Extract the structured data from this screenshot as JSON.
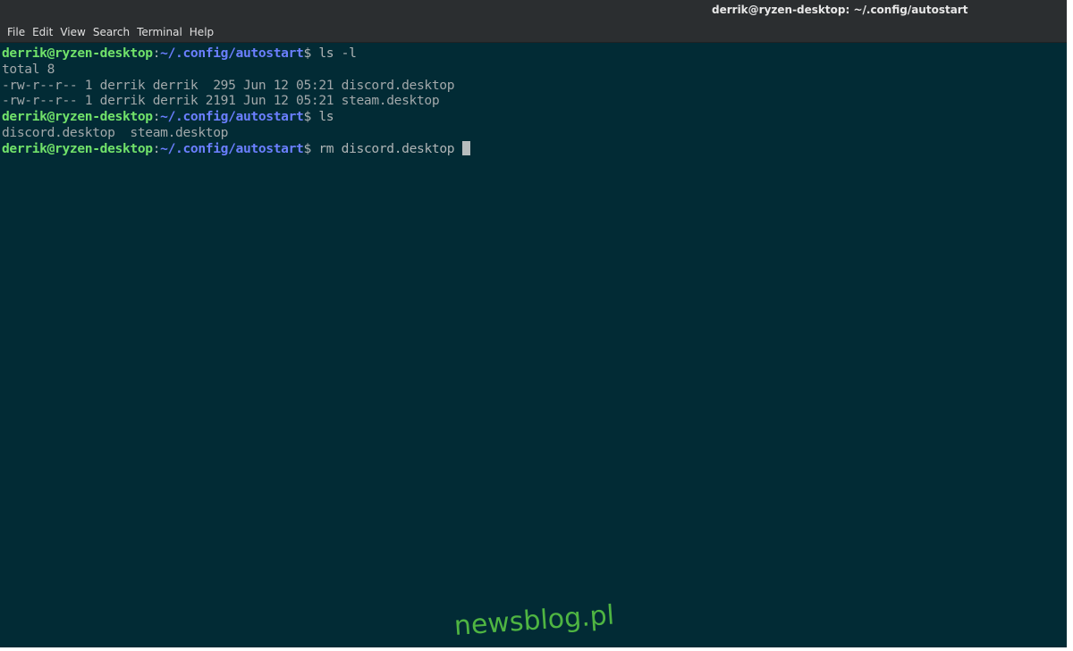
{
  "window": {
    "title": "derrik@ryzen-desktop: ~/.config/autostart"
  },
  "menu": {
    "items": [
      "File",
      "Edit",
      "View",
      "Search",
      "Terminal",
      "Help"
    ]
  },
  "prompt": {
    "user_host": "derrik@ryzen-desktop",
    "colon": ":",
    "path": "~/.config/autostart",
    "dollar": "$"
  },
  "terminal": {
    "cmd1": " ls -l",
    "out_total": "total 8",
    "out_file1": "-rw-r--r-- 1 derrik derrik  295 Jun 12 05:21 discord.desktop",
    "out_file2": "-rw-r--r-- 1 derrik derrik 2191 Jun 12 05:21 steam.desktop",
    "cmd2": " ls",
    "out_ls": "discord.desktop  steam.desktop",
    "cmd3": " rm discord.desktop "
  },
  "watermark": "newsblog.pl",
  "colors": {
    "background": "#022b35",
    "prompt_user": "#71e26a",
    "prompt_path": "#6b7fff",
    "text": "#b0b5b6",
    "watermark": "#4fb542"
  }
}
